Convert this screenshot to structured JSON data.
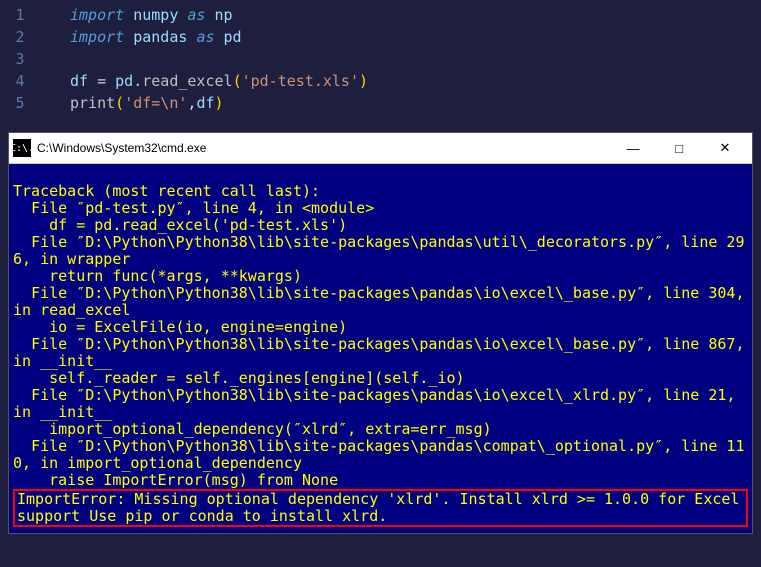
{
  "editor": {
    "lines": [
      {
        "num": "1",
        "tokens": [
          [
            "kw",
            "import"
          ],
          [
            "plain",
            " "
          ],
          [
            "ident",
            "numpy"
          ],
          [
            "plain",
            " "
          ],
          [
            "kw",
            "as"
          ],
          [
            "plain",
            " "
          ],
          [
            "ident",
            "np"
          ]
        ]
      },
      {
        "num": "2",
        "tokens": [
          [
            "kw",
            "import"
          ],
          [
            "plain",
            " "
          ],
          [
            "ident",
            "pandas"
          ],
          [
            "plain",
            " "
          ],
          [
            "kw",
            "as"
          ],
          [
            "plain",
            " "
          ],
          [
            "ident",
            "pd"
          ]
        ]
      },
      {
        "num": "3",
        "tokens": []
      },
      {
        "num": "4",
        "tokens": [
          [
            "ident",
            "df"
          ],
          [
            "plain",
            " "
          ],
          [
            "punct",
            "="
          ],
          [
            "plain",
            " "
          ],
          [
            "ident",
            "pd"
          ],
          [
            "punct",
            "."
          ],
          [
            "func",
            "read_excel"
          ],
          [
            "paren",
            "("
          ],
          [
            "string",
            "'pd-test.xls'"
          ],
          [
            "paren",
            ")"
          ]
        ]
      },
      {
        "num": "5",
        "tokens": [
          [
            "func",
            "print"
          ],
          [
            "paren",
            "("
          ],
          [
            "string",
            "'df=\\n'"
          ],
          [
            "punct",
            ","
          ],
          [
            "ident",
            "df"
          ],
          [
            "paren",
            ")"
          ]
        ]
      }
    ]
  },
  "terminal": {
    "icon_label": "C:\\.",
    "title": "C:\\Windows\\System32\\cmd.exe",
    "minimize": "—",
    "maximize": "□",
    "close": "✕",
    "traceback": "Traceback (most recent call last):\n  File ″pd-test.py″, line 4, in <module>\n    df = pd.read_excel('pd-test.xls')\n  File ″D:\\Python\\Python38\\lib\\site-packages\\pandas\\util\\_decorators.py″, line 296, in wrapper\n    return func(*args, **kwargs)\n  File ″D:\\Python\\Python38\\lib\\site-packages\\pandas\\io\\excel\\_base.py″, line 304, in read_excel\n    io = ExcelFile(io, engine=engine)\n  File ″D:\\Python\\Python38\\lib\\site-packages\\pandas\\io\\excel\\_base.py″, line 867, in __init__\n    self._reader = self._engines[engine](self._io)\n  File ″D:\\Python\\Python38\\lib\\site-packages\\pandas\\io\\excel\\_xlrd.py″, line 21, in __init__\n    import_optional_dependency(″xlrd″, extra=err_msg)\n  File ″D:\\Python\\Python38\\lib\\site-packages\\pandas\\compat\\_optional.py″, line 110, in import_optional_dependency\n    raise ImportError(msg) from None",
    "error": "ImportError: Missing optional dependency 'xlrd'. Install xlrd >= 1.0.0 for Excel support Use pip or conda to install xlrd."
  }
}
